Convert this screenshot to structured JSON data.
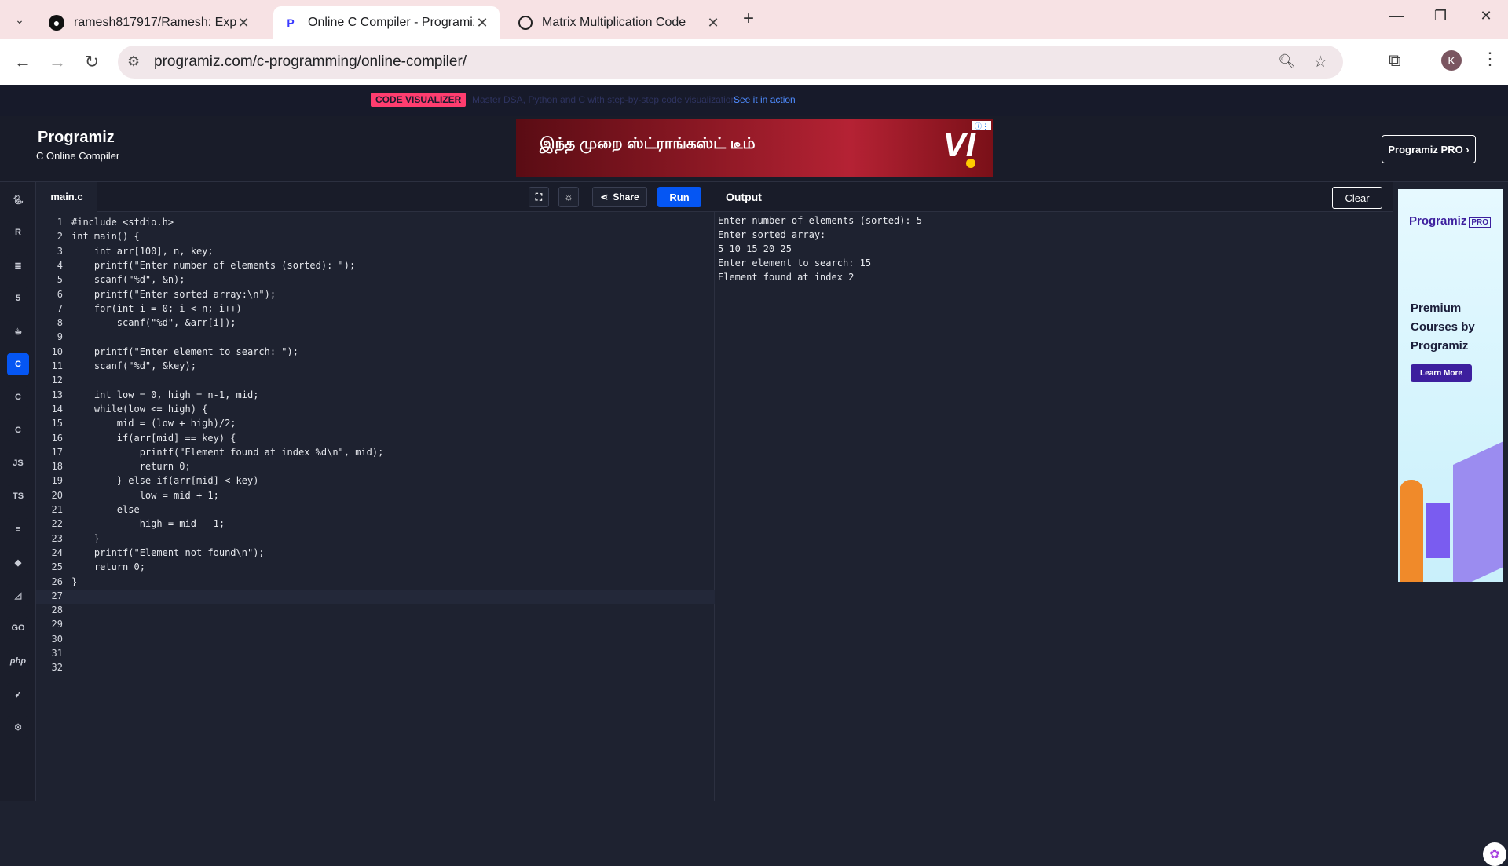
{
  "browser": {
    "tabs": [
      {
        "title": "ramesh817917/Ramesh: Experin",
        "icon": "github-icon"
      },
      {
        "title": "Online C Compiler - Programiz",
        "icon": "programiz-icon"
      },
      {
        "title": "Matrix Multiplication Code",
        "icon": "openai-icon"
      }
    ],
    "new_tab": "+",
    "url": "programiz.com/c-programming/online-compiler/",
    "profile_initial": "K"
  },
  "promo": {
    "badge": "CODE VISUALIZER",
    "text": "Master DSA, Python and C with step-by-step code visualization.",
    "link": "See it in action"
  },
  "header": {
    "logo": "Programiz",
    "subtitle": "C Online Compiler",
    "pro_button": "Programiz PRO ›"
  },
  "ad_banner": {
    "text": "இந்த முறை ஸ்ட்ராங்கஸ்ட் டீம்",
    "brand": "VI"
  },
  "languages": [
    "python-icon",
    "r-icon",
    "sql-icon",
    "html-icon",
    "java-icon",
    "c-icon",
    "cpp-icon",
    "csharp-icon",
    "JS",
    "TS",
    "go-icon",
    "ruby-icon",
    "scala-icon",
    "GO",
    "php",
    "swift-icon",
    "rust-icon"
  ],
  "editor": {
    "file_tab": "main.c",
    "share_label": "Share",
    "run_label": "Run",
    "lines": [
      "#include <stdio.h>",
      "int main() {",
      "    int arr[100], n, key;",
      "    printf(\"Enter number of elements (sorted): \");",
      "    scanf(\"%d\", &n);",
      "    printf(\"Enter sorted array:\\n\");",
      "    for(int i = 0; i < n; i++)",
      "        scanf(\"%d\", &arr[i]);",
      "",
      "    printf(\"Enter element to search: \");",
      "    scanf(\"%d\", &key);",
      "",
      "    int low = 0, high = n-1, mid;",
      "    while(low <= high) {",
      "        mid = (low + high)/2;",
      "        if(arr[mid] == key) {",
      "            printf(\"Element found at index %d\\n\", mid);",
      "            return 0;",
      "        } else if(arr[mid] < key)",
      "            low = mid + 1;",
      "        else",
      "            high = mid - 1;",
      "    }",
      "    printf(\"Element not found\\n\");",
      "    return 0;",
      "}",
      "",
      "",
      "",
      "",
      "",
      ""
    ]
  },
  "output": {
    "title": "Output",
    "clear_label": "Clear",
    "lines": [
      "Enter number of elements (sorted): 5",
      "Enter sorted array:",
      "5 10 15 20 25",
      "Enter element to search: 15",
      "Element found at index 2"
    ]
  },
  "right_ad": {
    "brand": "Programiz",
    "brand_tag": "PRO",
    "headline": "Premium Courses by Programiz",
    "cta": "Learn More"
  }
}
